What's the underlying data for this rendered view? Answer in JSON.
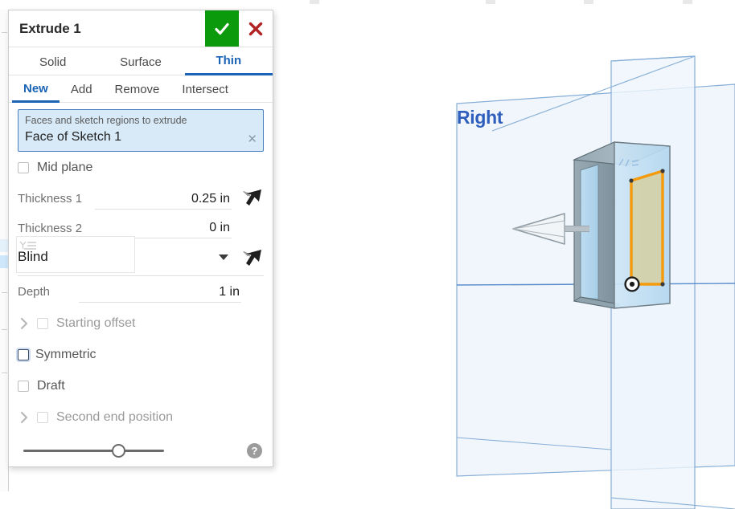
{
  "dialog": {
    "title": "Extrude 1",
    "confirm_label": "✓",
    "confirm_name": "accept-button",
    "cancel_label": "✕",
    "accent_blue": "#1b63b5",
    "accept_green": "#0b9a0b",
    "cancel_red": "#b22222",
    "primary_tabs": [
      {
        "label": "Solid",
        "active": false
      },
      {
        "label": "Surface",
        "active": false
      },
      {
        "label": "Thin",
        "active": true
      }
    ],
    "secondary_tabs": [
      {
        "label": "New",
        "active": true
      },
      {
        "label": "Add",
        "active": false
      },
      {
        "label": "Remove",
        "active": false
      },
      {
        "label": "Intersect",
        "active": false
      }
    ],
    "selection": {
      "prompt": "Faces and sketch regions to extrude",
      "value": "Face of Sketch 1",
      "clear_label": "✕"
    },
    "mid_plane": {
      "label": "Mid plane",
      "checked": false
    },
    "thickness_1": {
      "label": "Thickness 1",
      "value": "0.25 in"
    },
    "thickness_2": {
      "label": "Thickness 2",
      "value": "0 in"
    },
    "end_condition": {
      "value": "Blind"
    },
    "depth": {
      "label": "Depth",
      "value": "1 in"
    },
    "starting_offset": {
      "label": "Starting offset",
      "checked": false,
      "expanded": false
    },
    "symmetric": {
      "label": "Symmetric",
      "checked": false,
      "focused": true
    },
    "draft": {
      "label": "Draft",
      "checked": false
    },
    "second_end_position": {
      "label": "Second end position",
      "checked": false,
      "expanded": false
    },
    "opacity_slider": {
      "value": 63
    },
    "help_label": "?"
  },
  "viewport": {
    "plane_label": "Right",
    "plane_label_color": "#2f5fbd",
    "plane_fill": "#eef5fb",
    "plane_stroke": "#86aed6",
    "sketch_outline_color": "#f59a0b",
    "sketch_fill_color": "#d4d1a6",
    "body_face_color": "#bcdcf0",
    "body_side_color": "#8fa3ae",
    "background": "#ffffff"
  }
}
